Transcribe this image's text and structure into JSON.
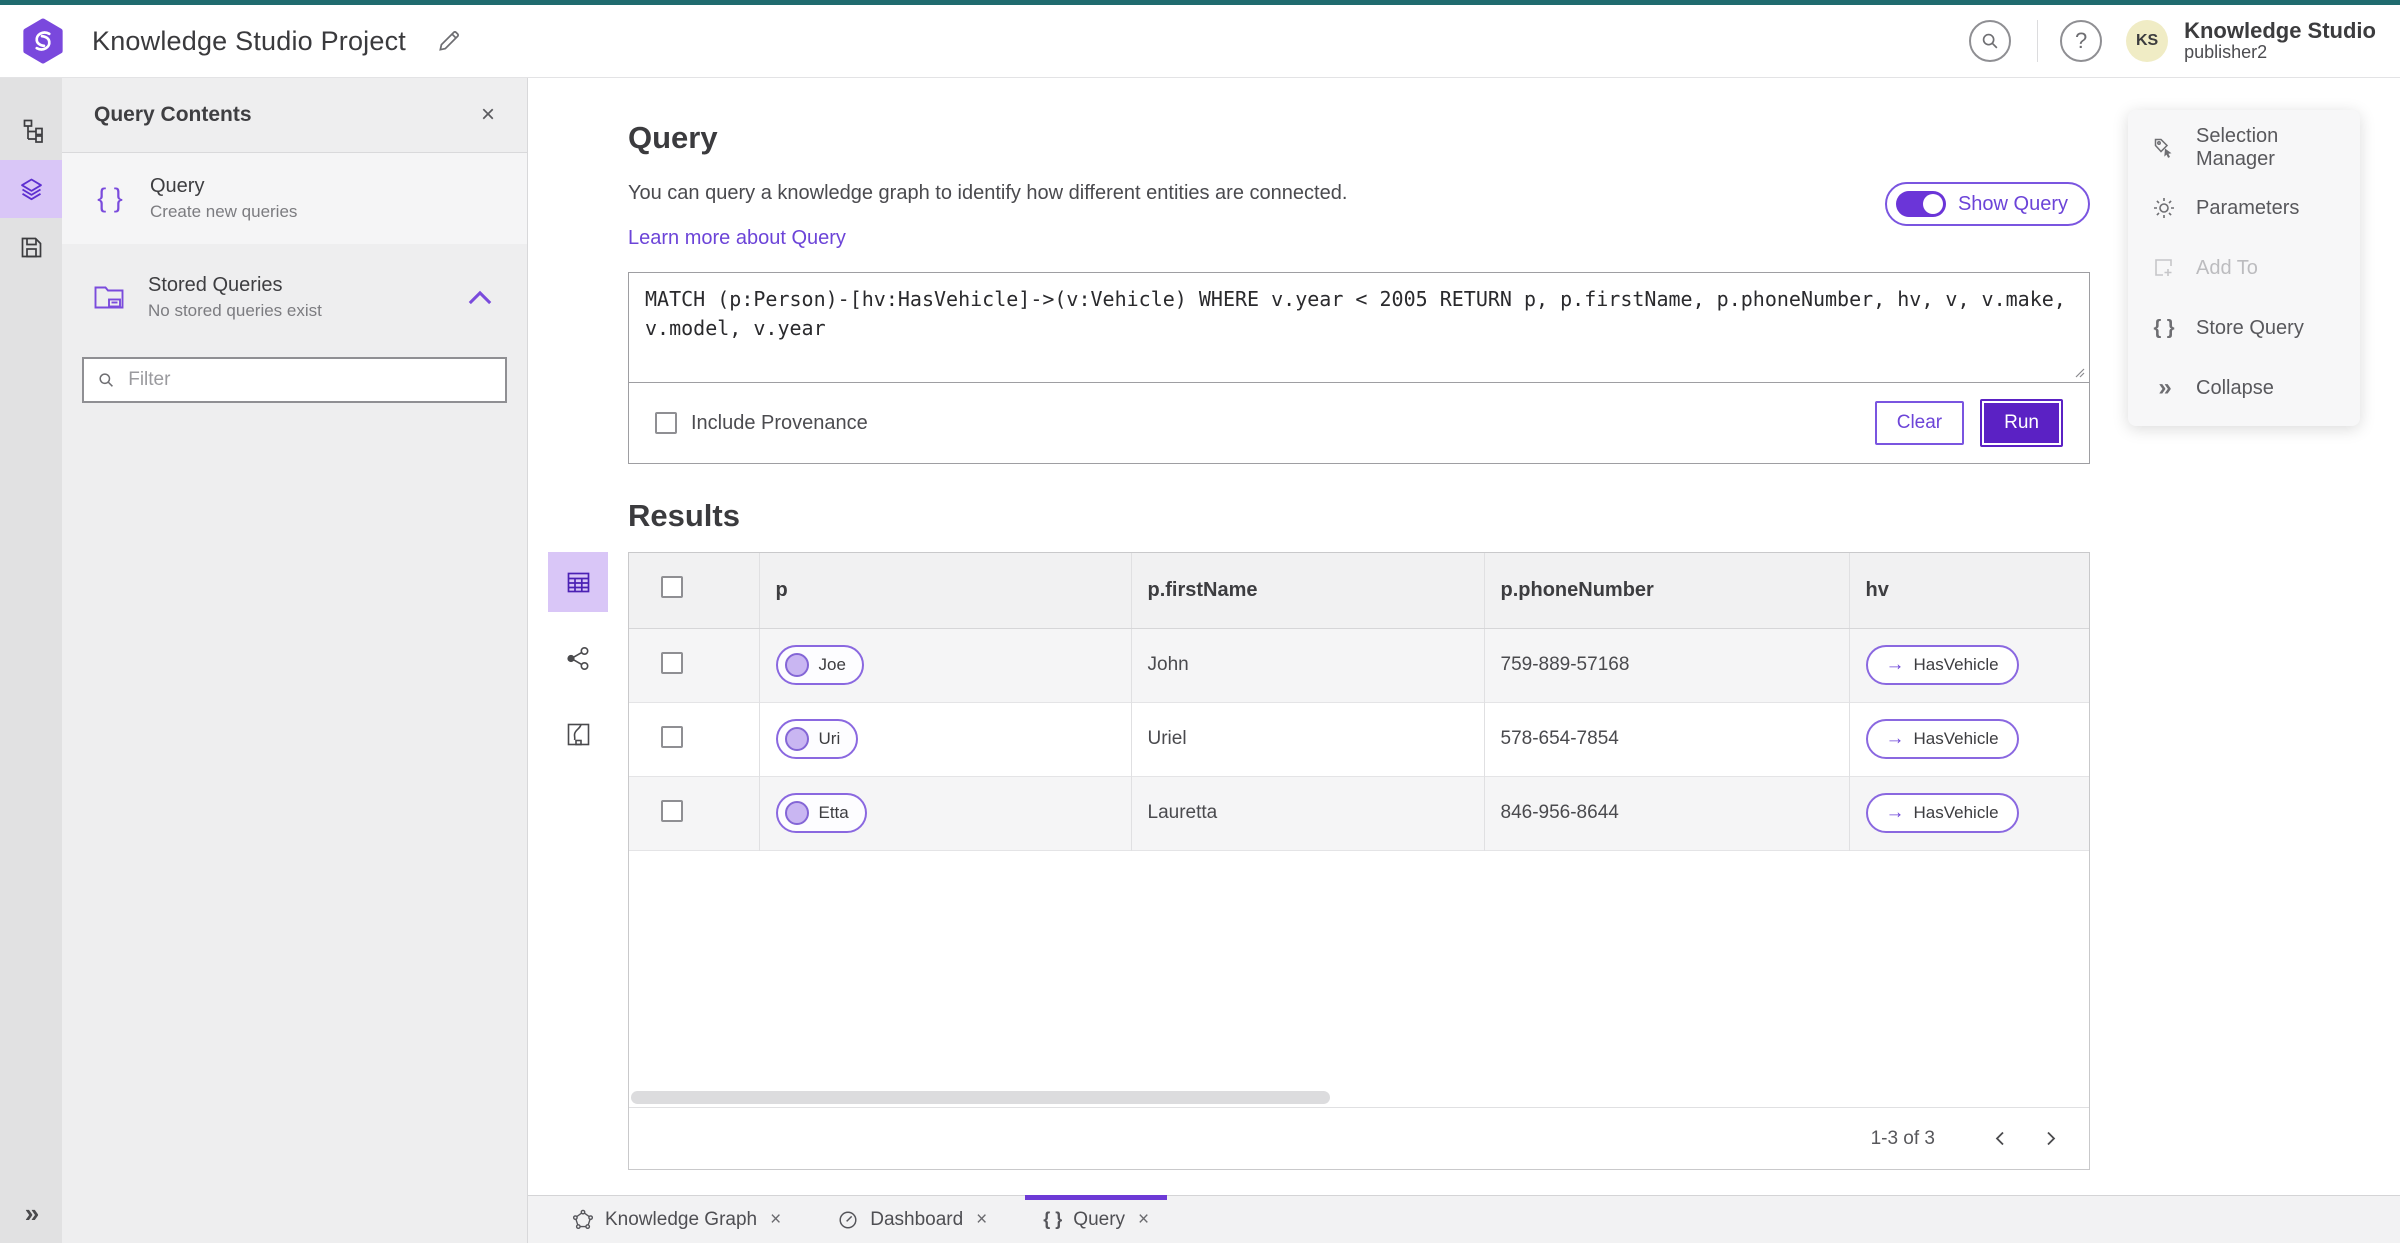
{
  "header": {
    "title": "Knowledge Studio Project",
    "brand": "Knowledge Studio",
    "user": "publisher2",
    "avatar": "KS"
  },
  "left_panel": {
    "title": "Query Contents",
    "query_item": {
      "label": "Query",
      "description": "Create new queries"
    },
    "stored_item": {
      "label": "Stored Queries",
      "description": "No stored queries exist"
    },
    "filter_placeholder": "Filter"
  },
  "query": {
    "heading": "Query",
    "description": "You can query a knowledge graph to identify how different entities are connected.",
    "learn_more": "Learn more about Query",
    "show_query": "Show Query",
    "text": "MATCH (p:Person)-[hv:HasVehicle]->(v:Vehicle) WHERE v.year < 2005 RETURN p, p.firstName, p.phoneNumber, hv, v, v.make, v.model, v.year",
    "include_provenance": "Include Provenance",
    "clear": "Clear",
    "run": "Run"
  },
  "results": {
    "heading": "Results",
    "columns": [
      "p",
      "p.firstName",
      "p.phoneNumber",
      "hv"
    ],
    "rows": [
      {
        "p": "Joe",
        "firstName": "John",
        "phone": "759-889-57168",
        "hv": "HasVehicle"
      },
      {
        "p": "Uri",
        "firstName": "Uriel",
        "phone": "578-654-7854",
        "hv": "HasVehicle"
      },
      {
        "p": "Etta",
        "firstName": "Lauretta",
        "phone": "846-956-8644",
        "hv": "HasVehicle"
      }
    ],
    "range": "1-3 of 3"
  },
  "right_menu": {
    "items": [
      {
        "label": "Selection Manager"
      },
      {
        "label": "Parameters"
      },
      {
        "label": "Add To"
      },
      {
        "label": "Store Query"
      },
      {
        "label": "Collapse"
      }
    ]
  },
  "tabs": [
    {
      "label": "Knowledge Graph"
    },
    {
      "label": "Dashboard"
    },
    {
      "label": "Query"
    }
  ],
  "icons": {
    "braces": "{ }",
    "arrow_right": "→",
    "chevrons": "»",
    "close": "×",
    "help": "?"
  },
  "colors": {
    "accent_purple": "#6c44d8",
    "deep_purple": "#5b21c4",
    "active_highlight": "#d9c6f7",
    "teal_strip": "#206b6f",
    "avatar_bg": "#f0ecc5"
  }
}
